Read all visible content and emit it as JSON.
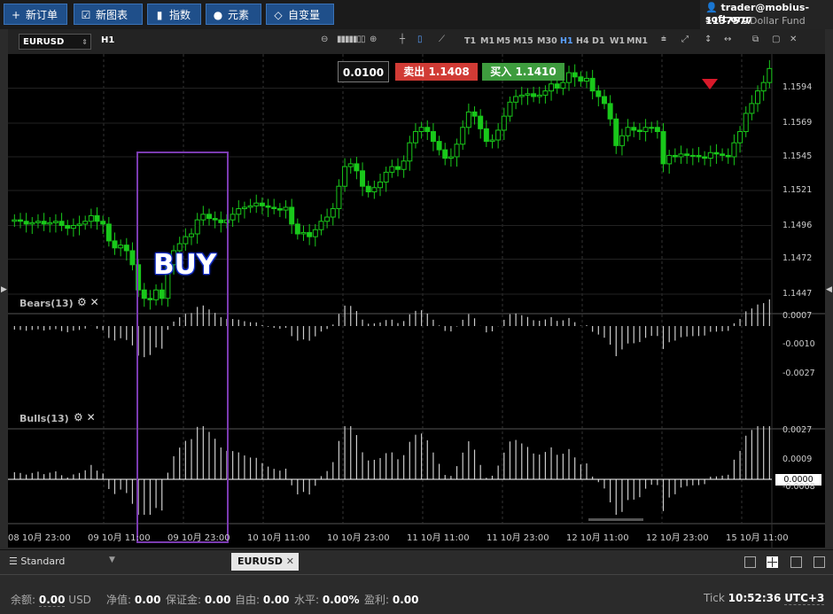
{
  "toolbar": {
    "buttons": [
      {
        "label": "新订单",
        "icon": "plus-icon"
      },
      {
        "label": "新图表",
        "icon": "chart-window-icon"
      },
      {
        "label": "指数",
        "icon": "bar-chart-icon"
      },
      {
        "label": "元素",
        "icon": "shapes-icon"
      },
      {
        "label": "自变量",
        "icon": "diamond-icon"
      }
    ]
  },
  "account": {
    "email": "trader@mobius-soft.org",
    "id": "1137577",
    "fund": "Dollar Fund"
  },
  "chart_toolbar": {
    "symbol": "EURUSD",
    "timeframe": "H1",
    "timeframes": [
      "T1",
      "M1",
      "M5",
      "M15",
      "M30",
      "H1",
      "H4",
      "D1",
      "W1",
      "MN1"
    ],
    "active_timeframe": "H1"
  },
  "ticket": {
    "lot": "0.0100",
    "sell_label": "卖出",
    "sell_price": "1.1408",
    "buy_label": "买入",
    "buy_price": "1.1410"
  },
  "annotation": {
    "label": "BUY",
    "box_color": "#7a3bb0"
  },
  "price_axis": [
    "1.1594",
    "1.1569",
    "1.1545",
    "1.1521",
    "1.1496",
    "1.1472",
    "1.1447"
  ],
  "bears": {
    "title": "Bears(13)",
    "ticks": [
      "0.0007",
      "-0.0010",
      "-0.0027"
    ]
  },
  "bulls": {
    "title": "Bulls(13)",
    "ticks": [
      "0.0027",
      "0.0009",
      "0.0000",
      "-0.0008"
    ]
  },
  "time_axis": [
    "08 10月 23:00",
    "09 10月 11:00",
    "09 10月 23:00",
    "10 10月 11:00",
    "10 10月 23:00",
    "11 10月 11:00",
    "11 10月 23:00",
    "12 10月 11:00",
    "12 10月 23:00",
    "15 10月 11:00"
  ],
  "colors": {
    "bull_candle": "#19c81a",
    "bear_candle": "#19c81a",
    "sell": "#d13b35",
    "buy": "#3e9c3e",
    "accent": "#1f4f8a"
  },
  "chart_data": {
    "type": "candlestick",
    "ylim": [
      1.1435,
      1.1612
    ],
    "close": [
      1.15,
      1.1499,
      1.1497,
      1.1498,
      1.1499,
      1.1497,
      1.1498,
      1.1499,
      1.1496,
      1.1494,
      1.1496,
      1.1497,
      1.1499,
      1.1503,
      1.1499,
      1.1497,
      1.1485,
      1.148,
      1.1482,
      1.1478,
      1.1468,
      1.145,
      1.1444,
      1.1443,
      1.145,
      1.1444,
      1.1468,
      1.1478,
      1.1483,
      1.1488,
      1.149,
      1.15,
      1.1504,
      1.1501,
      1.15,
      1.1498,
      1.15,
      1.1504,
      1.1508,
      1.1509,
      1.151,
      1.1512,
      1.151,
      1.1509,
      1.1508,
      1.1507,
      1.1509,
      1.1497,
      1.149,
      1.1491,
      1.1488,
      1.1493,
      1.1499,
      1.1502,
      1.1508,
      1.1524,
      1.1538,
      1.154,
      1.1535,
      1.1524,
      1.152,
      1.1523,
      1.1527,
      1.1534,
      1.1538,
      1.1536,
      1.1542,
      1.1555,
      1.1563,
      1.1566,
      1.1563,
      1.1556,
      1.155,
      1.1544,
      1.1545,
      1.1554,
      1.1566,
      1.1577,
      1.1574,
      1.1565,
      1.1556,
      1.1557,
      1.1564,
      1.1574,
      1.1584,
      1.1588,
      1.1589,
      1.159,
      1.1588,
      1.1589,
      1.1592,
      1.1597,
      1.1594,
      1.1598,
      1.1605,
      1.1602,
      1.1599,
      1.1601,
      1.1592,
      1.1588,
      1.1583,
      1.1572,
      1.1553,
      1.156,
      1.1566,
      1.1564,
      1.1563,
      1.1566,
      1.1566,
      1.1563,
      1.154,
      1.1546,
      1.1545,
      1.1547,
      1.1546,
      1.1546,
      1.1545,
      1.1544,
      1.1548,
      1.1547,
      1.1546,
      1.1545,
      1.1555,
      1.1563,
      1.1576,
      1.1583,
      1.1592,
      1.1598,
      1.1608
    ]
  }
}
